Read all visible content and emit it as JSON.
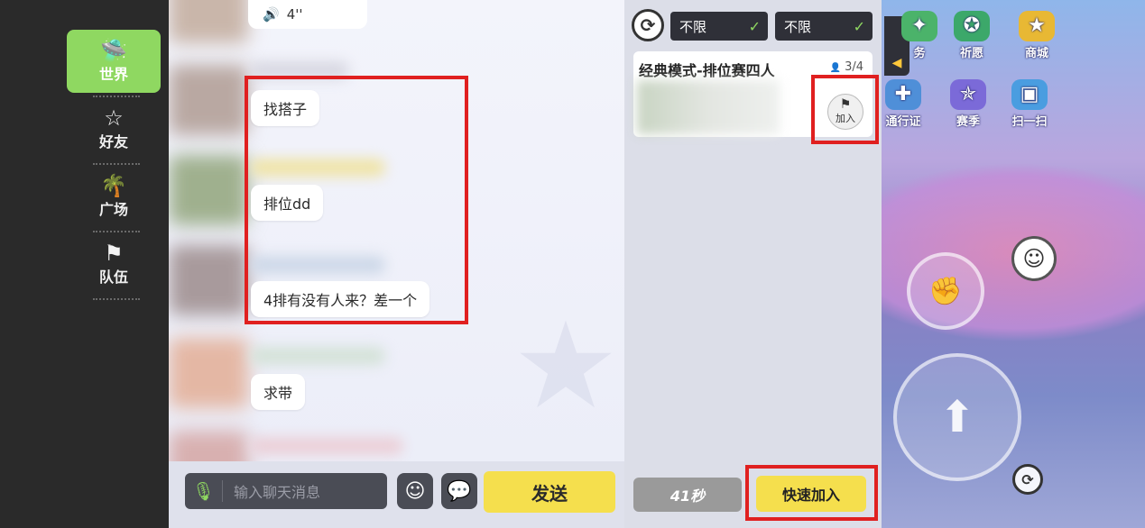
{
  "nav": {
    "items": [
      {
        "label": "世界",
        "icon": "ufo-icon",
        "glyph": "🛸"
      },
      {
        "label": "好友",
        "icon": "star-friend-icon",
        "glyph": "☆"
      },
      {
        "label": "广场",
        "icon": "palm-tree-icon",
        "glyph": "🌴"
      },
      {
        "label": "队伍",
        "icon": "flag-icon",
        "glyph": "⚑"
      }
    ]
  },
  "chat": {
    "voice": {
      "glyph": "🔊",
      "duration": "4''"
    },
    "messages": [
      {
        "text": "找搭子"
      },
      {
        "text": "排位dd"
      },
      {
        "text": "4排有没有人来？差一个"
      },
      {
        "text": "求带"
      }
    ],
    "input": {
      "placeholder": "输入聊天消息",
      "mic_glyph": "🎙"
    },
    "emoji_glyph": "☺",
    "more_glyph": "💬",
    "send_label": "发送"
  },
  "teams": {
    "refresh_glyph": "⟳",
    "filters": [
      {
        "value": "不限",
        "chev": "✓"
      },
      {
        "value": "不限",
        "chev": "✓"
      }
    ],
    "room": {
      "title": "经典模式-排位赛四人",
      "count": "3/4",
      "count_glyph": "👤",
      "join_label": "加入",
      "join_glyph": "⚑"
    },
    "timer_label": "41秒",
    "quick_join_label": "快速加入"
  },
  "game": {
    "top_icons": [
      {
        "label": "务",
        "glyph": "✦"
      },
      {
        "label": "祈愿",
        "glyph": "✪"
      },
      {
        "label": "商城",
        "glyph": "★"
      },
      {
        "label": "通行证",
        "glyph": "✚"
      },
      {
        "label": "赛季",
        "glyph": "✯"
      },
      {
        "label": "扫一扫",
        "glyph": "▣"
      }
    ],
    "flag_tab_glyph": "◀",
    "emoji_glyph": "☺",
    "reload_glyph": "⟳",
    "ctrl_top_glyph": "✊",
    "ctrl_bottom_glyph": "⬆"
  },
  "colors": {
    "accent_green": "#8fd861",
    "send_yellow": "#f5df4d",
    "highlight_red": "#e02020"
  }
}
